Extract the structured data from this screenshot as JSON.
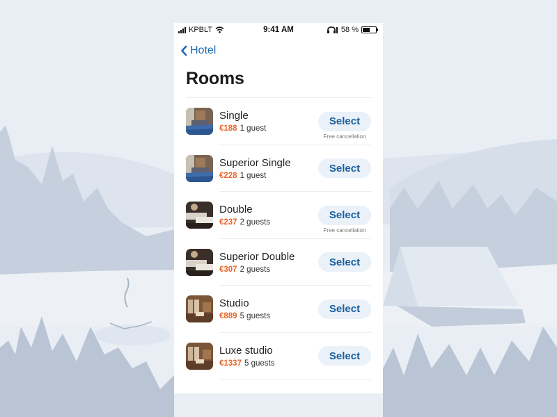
{
  "colors": {
    "accent": "#1a6bb3",
    "button_text": "#1a5fa0",
    "button_bg": "#eaf1f8",
    "price": "#e8662a",
    "background": "#e9eef5"
  },
  "status_bar": {
    "carrier": "KPBLT",
    "time": "9:41 AM",
    "battery_label": "58 %",
    "battery_level": 0.58,
    "icons": [
      "signal-icon",
      "wifi-icon",
      "headphones-icon",
      "battery-icon"
    ]
  },
  "nav": {
    "back_label": "Hotel",
    "back_icon": "chevron-left-icon"
  },
  "page": {
    "title": "Rooms"
  },
  "rooms": [
    {
      "name": "Single",
      "price": "€188",
      "guests": "1 guest",
      "button": "Select",
      "note": "Free cancellation",
      "photo": "room-photo-blue"
    },
    {
      "name": "Superior Single",
      "price": "€228",
      "guests": "1 guest",
      "button": "Select",
      "note": "",
      "photo": "room-photo-blue"
    },
    {
      "name": "Double",
      "price": "€237",
      "guests": "2 guests",
      "button": "Select",
      "note": "Free cancellation",
      "photo": "room-photo-dark"
    },
    {
      "name": "Superior Double",
      "price": "€307",
      "guests": "2 guests",
      "button": "Select",
      "note": "",
      "photo": "room-photo-dark"
    },
    {
      "name": "Studio",
      "price": "€889",
      "guests": "5 guests",
      "button": "Select",
      "note": "",
      "photo": "room-photo-wood"
    },
    {
      "name": "Luxe studio",
      "price": "€1337",
      "guests": "5 guests",
      "button": "Select",
      "note": "",
      "photo": "room-photo-wood"
    }
  ]
}
